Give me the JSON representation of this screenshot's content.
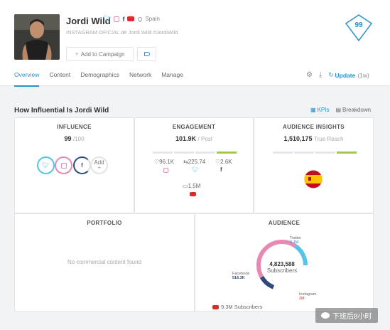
{
  "profile": {
    "name": "Jordi Wild",
    "country": "Spain",
    "subtitle": "INSTAGRAM OFICIAL de Jordi Wild #JordiWild",
    "add_campaign_label": "Add to Campaign",
    "score": "99"
  },
  "tabs": [
    "Overview",
    "Content",
    "Demographics",
    "Network",
    "Manage"
  ],
  "update_label": "Update",
  "update_age": "(1w)",
  "section_title": "How Influential Is Jordi Wild",
  "view_toggle": {
    "kpis": "KPIs",
    "breakdown": "Breakdown"
  },
  "influence": {
    "title": "INFLUENCE",
    "value": "99",
    "suffix": "/100",
    "add_label": "Add",
    "add_plus": "+"
  },
  "engagement": {
    "title": "ENGAGEMENT",
    "value": "101.9K",
    "suffix": "/ Post",
    "instagram_likes": "96.1K",
    "twitter_retweets": "225.74",
    "facebook_likes": "2.6K",
    "youtube_views": "1.5M"
  },
  "audience_insights": {
    "title": "AUDIENCE INSIGHTS",
    "value": "1,510,175",
    "suffix": "True Reach"
  },
  "portfolio": {
    "title": "PORTFOLIO",
    "empty_text": "No commercial content found"
  },
  "audience": {
    "title": "AUDIENCE",
    "total": "4,823,588",
    "total_label": "Subscribers",
    "twitter_label": "Twitter",
    "twitter_value": "2.1M",
    "facebook_label": "Facebook",
    "facebook_value": "516.3K",
    "instagram_label": "Instagram",
    "instagram_value": "2M",
    "youtube_subscribers": "9.3M Subscribers"
  },
  "watermark": "下班后8小时",
  "colors": {
    "accent": "#2a8fcf",
    "twitter": "#55c4e8",
    "instagram": "#e889b3",
    "facebook": "#2f4a7a",
    "youtube": "#e02a2a",
    "score": "#2a8fcf"
  }
}
